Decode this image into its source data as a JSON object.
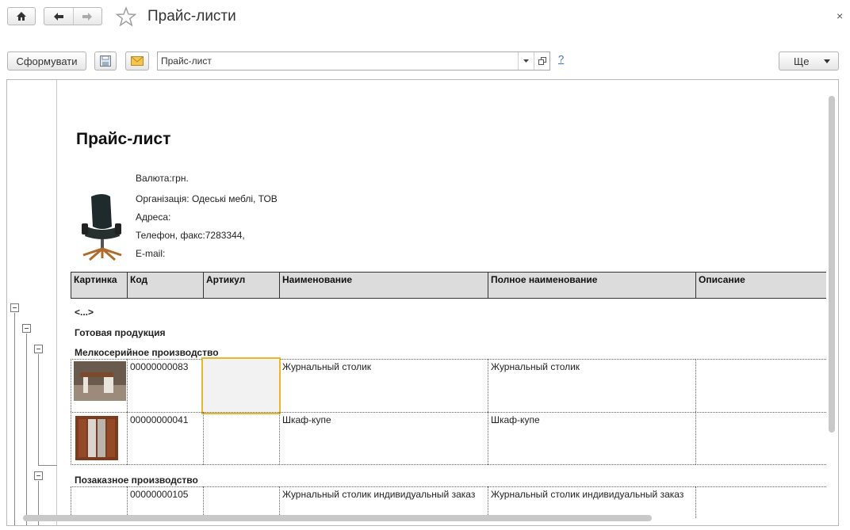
{
  "window": {
    "title": "Прайс-листи",
    "home_icon": "home-icon",
    "back_icon": "arrow-left-icon",
    "forward_icon": "arrow-right-icon",
    "favorite_icon": "star-icon",
    "close_icon": "close-icon",
    "close_glyph": "×"
  },
  "toolbar": {
    "generate_label": "Сформувати",
    "save_icon": "floppy-disk-icon",
    "email_icon": "envelope-icon",
    "price_list_field": {
      "value": "Прайс-лист"
    },
    "help_label": "?",
    "more_label": "Ще"
  },
  "report": {
    "title": "Прайс-лист",
    "header_lines": [
      "Валюта:грн.",
      "Організація: Одеські меблі, ТОВ",
      "Адреса:",
      "Телефон, факс:7283344,",
      "E-mail:"
    ],
    "columns": [
      "Картинка",
      "Код",
      "Артикул",
      "Наименование",
      "Полное наименование",
      "Описание"
    ],
    "ellipsis_row": "<...>",
    "groups": {
      "top": "Готовая продукция",
      "serial": "Мелкосерийное производство",
      "custom": "Позаказное производство"
    },
    "rows": [
      {
        "code": "00000000083",
        "article": "",
        "name": "Журнальный столик",
        "full_name": "Журнальный столик",
        "description": "",
        "image": "coffee-table-photo"
      },
      {
        "code": "00000000041",
        "article": "",
        "name": "Шкаф-купе",
        "full_name": "Шкаф-купе",
        "description": "",
        "image": "wardrobe-photo"
      },
      {
        "code": "00000000105",
        "article": "",
        "name": "Журнальный столик индивидуальный заказ",
        "full_name": "Журнальный столик индивидуальный заказ",
        "description": "",
        "image": ""
      }
    ]
  },
  "colors": {
    "selection_border": "#e9b72b",
    "header_fill": "#dcdcdc",
    "link": "#3a6fd1"
  }
}
